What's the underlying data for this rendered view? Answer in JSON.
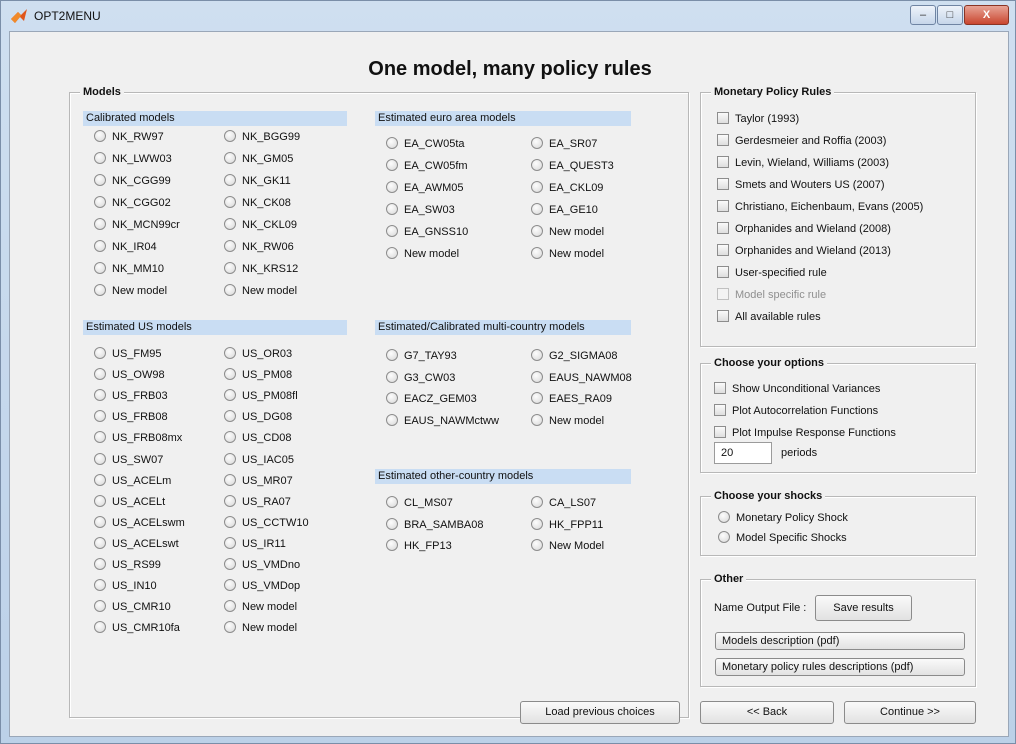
{
  "window": {
    "title": "OPT2MENU",
    "min_label": "–",
    "max_label": "□",
    "close_label": "X"
  },
  "main_title": "One model, many policy rules",
  "models": {
    "title": "Models",
    "calibrated": {
      "title": "Calibrated models",
      "items": [
        "NK_RW97",
        "NK_BGG99",
        "NK_LWW03",
        "NK_GM05",
        "NK_CGG99",
        "NK_GK11",
        "NK_CGG02",
        "NK_CK08",
        "NK_MCN99cr",
        "NK_CKL09",
        "NK_IR04",
        "NK_RW06",
        "NK_MM10",
        "NK_KRS12",
        "New model",
        "New model"
      ]
    },
    "us": {
      "title": "Estimated US models",
      "items": [
        "US_FM95",
        "US_OR03",
        "US_OW98",
        "US_PM08",
        "US_FRB03",
        "US_PM08fl",
        "US_FRB08",
        "US_DG08",
        "US_FRB08mx",
        "US_CD08",
        "US_SW07",
        "US_IAC05",
        "US_ACELm",
        "US_MR07",
        "US_ACELt",
        "US_RA07",
        "US_ACELswm",
        "US_CCTW10",
        "US_ACELswt",
        "US_IR11",
        "US_RS99",
        "US_VMDno",
        "US_IN10",
        "US_VMDop",
        "US_CMR10",
        "New model",
        "US_CMR10fa",
        "New model"
      ]
    },
    "euro": {
      "title": "Estimated euro area models",
      "items": [
        "EA_CW05ta",
        "EA_SR07",
        "EA_CW05fm",
        "EA_QUEST3",
        "EA_AWM05",
        "EA_CKL09",
        "EA_SW03",
        "EA_GE10",
        "EA_GNSS10",
        "New model",
        "New model",
        "New model"
      ]
    },
    "multi": {
      "title": "Estimated/Calibrated multi-country models",
      "items": [
        "G7_TAY93",
        "G2_SIGMA08",
        "G3_CW03",
        "EAUS_NAWM08",
        "EACZ_GEM03",
        "EAES_RA09",
        "EAUS_NAWMctww",
        "New model"
      ]
    },
    "other": {
      "title": "Estimated other-country models",
      "items": [
        "CL_MS07",
        "CA_LS07",
        "BRA_SAMBA08",
        "HK_FPP11",
        "HK_FP13",
        "New Model"
      ]
    }
  },
  "rules": {
    "title": "Monetary Policy Rules",
    "items": [
      {
        "label": "Taylor (1993)",
        "disabled": false
      },
      {
        "label": "Gerdesmeier and Roffia (2003)",
        "disabled": false
      },
      {
        "label": "Levin, Wieland, Williams (2003)",
        "disabled": false
      },
      {
        "label": "Smets and Wouters US (2007)",
        "disabled": false
      },
      {
        "label": "Christiano, Eichenbaum, Evans (2005)",
        "disabled": false
      },
      {
        "label": "Orphanides and Wieland (2008)",
        "disabled": false
      },
      {
        "label": "Orphanides and Wieland (2013)",
        "disabled": false
      },
      {
        "label": "User-specified rule",
        "disabled": false
      },
      {
        "label": "Model specific rule",
        "disabled": true
      },
      {
        "label": "All available rules",
        "disabled": false
      }
    ]
  },
  "options": {
    "title": "Choose your options",
    "items": [
      "Show Unconditional Variances",
      "Plot Autocorrelation Functions",
      "Plot Impulse Response Functions"
    ],
    "periods_value": "20",
    "periods_label": "periods"
  },
  "shocks": {
    "title": "Choose your shocks",
    "items": [
      "Monetary Policy Shock",
      "Model Specific Shocks"
    ]
  },
  "other": {
    "title": "Other",
    "name_label": "Name Output File :",
    "save_label": "Save results",
    "models_desc": "Models description (pdf)",
    "rules_desc": "Monetary policy rules descriptions (pdf)"
  },
  "footer": {
    "load": "Load previous choices",
    "back": "<< Back",
    "continue": "Continue >>"
  }
}
